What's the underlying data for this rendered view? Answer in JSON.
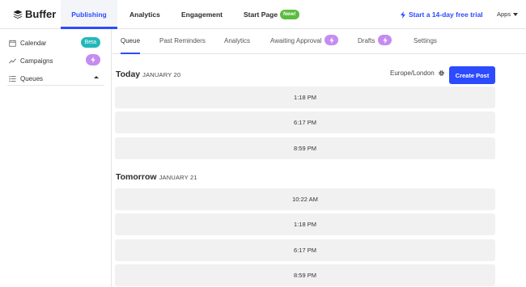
{
  "topnav": {
    "logo": "Buffer",
    "items": [
      "Publishing",
      "Analytics",
      "Engagement",
      "Start Page"
    ],
    "new_badge": "New!",
    "trial": "Start a 14-day free trial",
    "apps": "Apps"
  },
  "sidebar": {
    "items": [
      {
        "label": "Calendar",
        "icon": "calendar-icon",
        "badge": "Beta"
      },
      {
        "label": "Campaigns",
        "icon": "trend-icon",
        "badge_icon": "bolt-icon"
      },
      {
        "label": "Queues",
        "icon": "list-icon"
      }
    ]
  },
  "subtabs": [
    "Queue",
    "Past Reminders",
    "Analytics",
    "Awaiting Approval",
    "Drafts",
    "Settings"
  ],
  "main": {
    "timezone": "Europe/London",
    "create_button": "Create Post",
    "days": [
      {
        "label": "Today",
        "date": "JANUARY 20",
        "slots": [
          "1:18 PM",
          "6:17 PM",
          "8:59 PM"
        ]
      },
      {
        "label": "Tomorrow",
        "date": "JANUARY 21",
        "slots": [
          "10:22 AM",
          "1:18 PM",
          "6:17 PM",
          "8:59 PM"
        ]
      }
    ]
  },
  "colors": {
    "accent": "#2c4bff",
    "beta": "#23b8b8",
    "new": "#5bbc3e",
    "bolt": "#c58cf0",
    "slot": "#f1f1f1"
  }
}
